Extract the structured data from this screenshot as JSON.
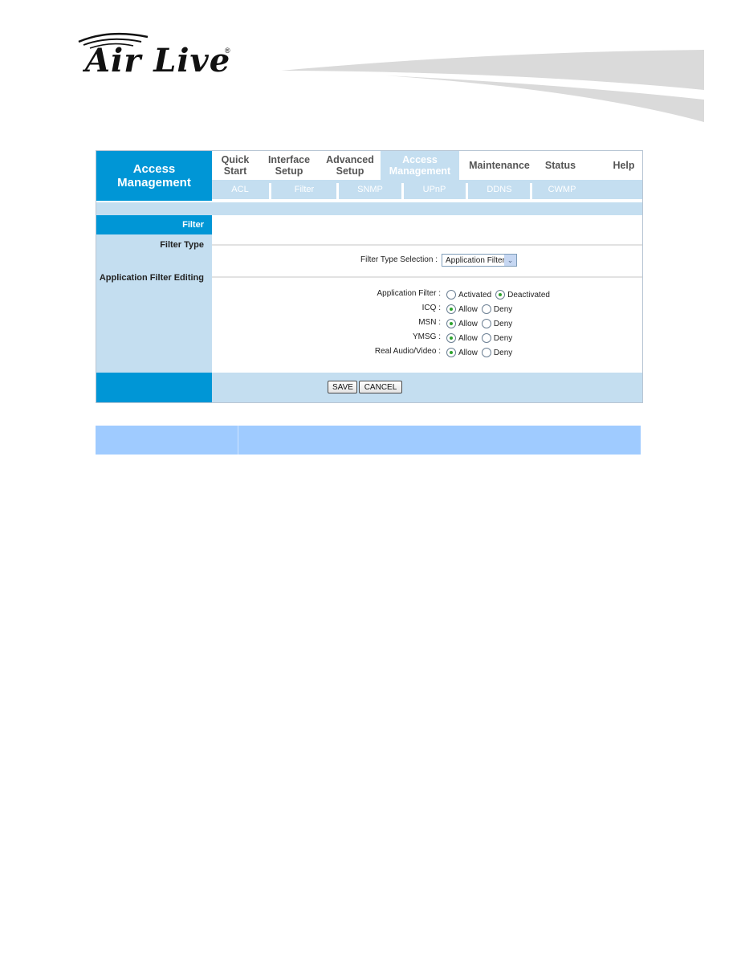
{
  "logo": {
    "text": "Air Live",
    "registered": "®"
  },
  "brand": {
    "title_line1": "Access",
    "title_line2": "Management"
  },
  "topnav": [
    {
      "line1": "Quick",
      "line2": "Start",
      "active": false
    },
    {
      "line1": "Interface",
      "line2": "Setup",
      "active": false
    },
    {
      "line1": "Advanced",
      "line2": "Setup",
      "active": false
    },
    {
      "line1": "Access",
      "line2": "Management",
      "active": true
    },
    {
      "line1": "Maintenance",
      "line2": "",
      "active": false
    },
    {
      "line1": "Status",
      "line2": "",
      "active": false
    },
    {
      "line1": "Help",
      "line2": "",
      "active": false
    }
  ],
  "subnav": [
    "ACL",
    "Filter",
    "SNMP",
    "UPnP",
    "DDNS",
    "CWMP"
  ],
  "section": {
    "header": "Filter",
    "filter_type_label": "Filter Type",
    "app_filter_editing_label": "Application Filter Editing"
  },
  "filter_type": {
    "label": "Filter Type Selection :",
    "selected": "Application Filter"
  },
  "app_filter": {
    "label": "Application Filter :",
    "options": [
      "Activated",
      "Deactivated"
    ],
    "selected": "Deactivated"
  },
  "apps": [
    {
      "label": "ICQ :",
      "allow": "Allow",
      "deny": "Deny",
      "selected": "Allow"
    },
    {
      "label": "MSN :",
      "allow": "Allow",
      "deny": "Deny",
      "selected": "Allow"
    },
    {
      "label": "YMSG :",
      "allow": "Allow",
      "deny": "Deny",
      "selected": "Allow"
    },
    {
      "label": "Real Audio/Video :",
      "allow": "Allow",
      "deny": "Deny",
      "selected": "Allow"
    }
  ],
  "buttons": {
    "save": "SAVE",
    "cancel": "CANCEL"
  },
  "colors": {
    "brand_blue": "#0096d6",
    "light_blue": "#c4def0",
    "bar_blue": "#9fcbff"
  }
}
